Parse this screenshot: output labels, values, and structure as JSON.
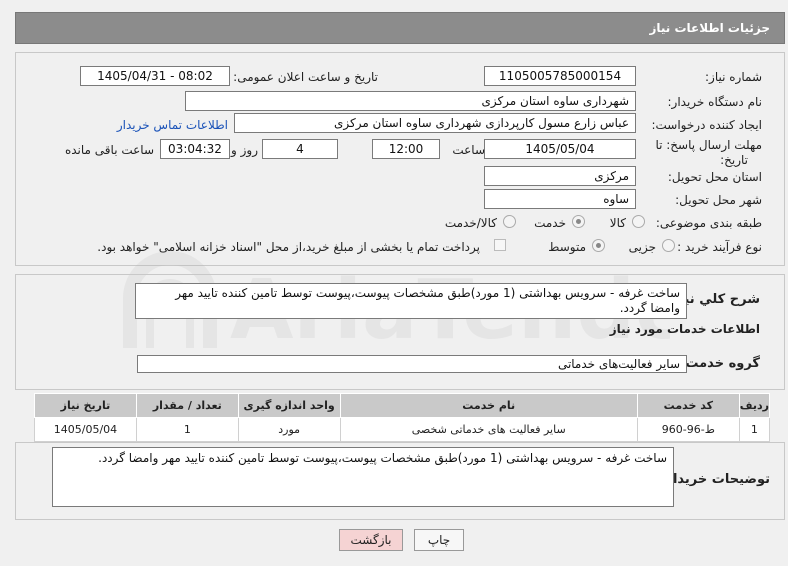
{
  "header": {
    "title": "جزئیات اطلاعات نیاز"
  },
  "form": {
    "need_number_label": "شماره نیاز:",
    "need_number": "1105005785000154",
    "announce_label": "تاریخ و ساعت اعلان عمومی:",
    "announce_value": "1405/04/31 - 08:02",
    "buyer_org_label": "نام دستگاه خریدار:",
    "buyer_org": "شهرداری ساوه استان مرکزی",
    "creator_label": "ایجاد کننده درخواست:",
    "creator": "عباس زارع مسول کارپردازی شهرداری ساوه استان مرکزی",
    "contact_link": "اطلاعات تماس خریدار",
    "deadline_label_1": "مهلت ارسال پاسخ: تا",
    "deadline_label_2": "تاریخ:",
    "deadline_date": "1405/05/04",
    "time_label": "ساعت",
    "deadline_time": "12:00",
    "days_value": "4",
    "days_label": "روز و",
    "remaining_value": "03:04:32",
    "remaining_label": "ساعت باقی مانده",
    "province_label": "استان محل تحویل:",
    "province": "مرکزی",
    "city_label": "شهر محل تحویل:",
    "city": "ساوه",
    "category_label": "طبقه بندی موضوعی:",
    "category_options": [
      "کالا",
      "خدمت",
      "کالا/خدمت"
    ],
    "category_selected": "خدمت",
    "process_label": "نوع فرآیند خرید :",
    "process_options": [
      "جزیی",
      "متوسط"
    ],
    "process_selected": "متوسط",
    "payment_note": "پرداخت تمام یا بخشی از مبلغ خرید،از محل \"اسناد خزانه اسلامی\" خواهد بود."
  },
  "general": {
    "desc_label": "شرح کلي نياز:",
    "desc": "ساخت غرفه - سرویس بهداشتی (1 مورد)طبق مشخصات پیوست،پیوست توسط تامین کننده تایید مهر وامضا گردد.",
    "services_title": "اطلاعات خدمات مورد نیاز",
    "group_label": "گروه خدمت:",
    "group_value": "سایر فعالیت‌های خدماتی"
  },
  "table": {
    "headers": [
      "ردیف",
      "کد خدمت",
      "نام خدمت",
      "واحد اندازه گیری",
      "تعداد / مقدار",
      "تاریخ نیاز"
    ],
    "rows": [
      [
        "1",
        "ط-96-960",
        "سایر فعالیت های خدماتی شخصی",
        "مورد",
        "1",
        "1405/05/04"
      ]
    ]
  },
  "buyer_notes": {
    "label": "توضیحات خریدار:",
    "text": "ساخت غرفه - سرویس بهداشتی (1 مورد)طبق مشخصات پیوست،پیوست توسط تامین کننده تایید مهر وامضا گردد."
  },
  "buttons": {
    "print": "چاپ",
    "back": "بازگشت"
  },
  "watermark": {
    "text": "AriaTender.neT"
  },
  "colors": {
    "header_bg": "#8c8c8c",
    "back_btn_bg": "#f5d3d3",
    "link": "#1a52b8"
  }
}
